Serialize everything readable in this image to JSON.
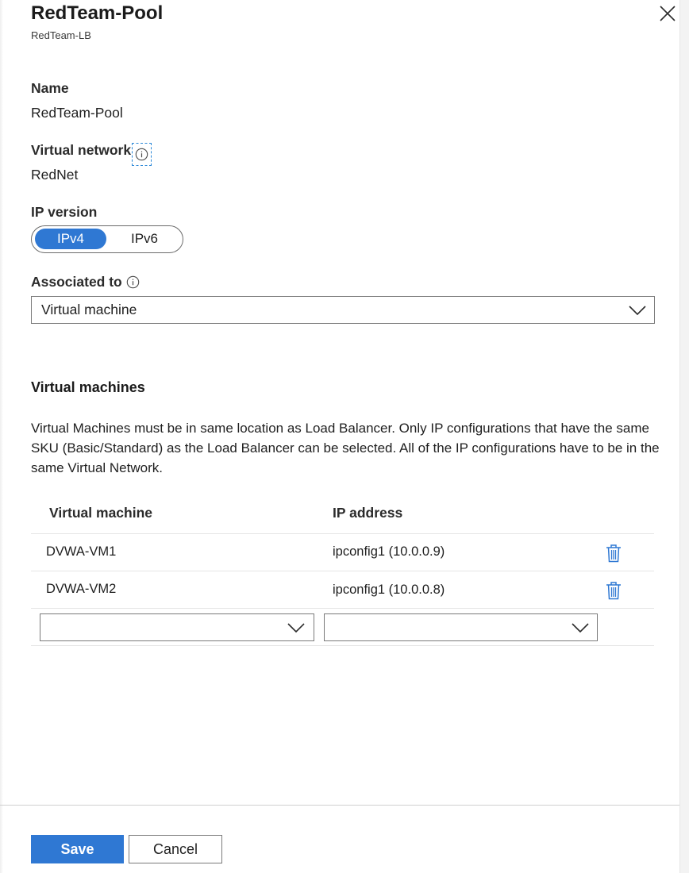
{
  "header": {
    "title": "RedTeam-Pool",
    "subtitle": "RedTeam-LB",
    "close_icon": "close-icon"
  },
  "fields": {
    "name_label": "Name",
    "name_value": "RedTeam-Pool",
    "vnet_label": "Virtual network",
    "vnet_value": "RedNet",
    "ip_version_label": "IP version",
    "ip_version_options": [
      "IPv4",
      "IPv6"
    ],
    "ip_version_selected": "IPv4",
    "associated_label": "Associated to",
    "associated_value": "Virtual machine"
  },
  "vm_section": {
    "title": "Virtual machines",
    "description": "Virtual Machines must be in same location as Load Balancer. Only IP configurations that have the same SKU (Basic/Standard) as the Load Balancer can be selected. All of the IP configurations have to be in the same Virtual Network.",
    "columns": [
      "Virtual machine",
      "IP address"
    ],
    "rows": [
      {
        "vm": "DVWA-VM1",
        "ip": "ipconfig1 (10.0.0.9)"
      },
      {
        "vm": "DVWA-VM2",
        "ip": "ipconfig1 (10.0.0.8)"
      }
    ],
    "new_row": {
      "vm": "",
      "ip": ""
    }
  },
  "footer": {
    "save_label": "Save",
    "cancel_label": "Cancel"
  },
  "colors": {
    "accent": "#2f78d3",
    "focus_outline": "#2b88d8"
  }
}
